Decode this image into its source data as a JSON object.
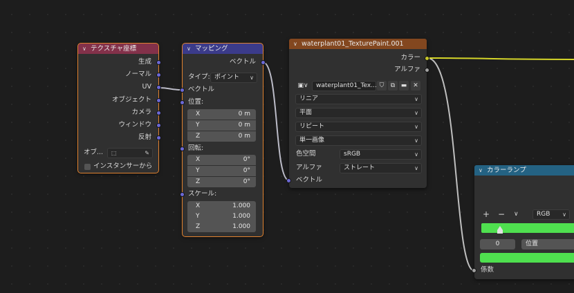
{
  "nodes": {
    "texcoord": {
      "title": "テクスチャ座標",
      "outputs": [
        "生成",
        "ノーマル",
        "UV",
        "オブジェクト",
        "カメラ",
        "ウィンドウ",
        "反射"
      ],
      "object_label": "オブ...",
      "instancer_label": "インスタンサーから",
      "header_color": "#83314a"
    },
    "mapping": {
      "title": "マッピング",
      "vector_out": "ベクトル",
      "type_label": "タイプ:",
      "type_value": "ポイント",
      "vector_in": "ベクトル",
      "location_label": "位置:",
      "location": [
        {
          "axis": "X",
          "value": "0 m"
        },
        {
          "axis": "Y",
          "value": "0 m"
        },
        {
          "axis": "Z",
          "value": "0 m"
        }
      ],
      "rotation_label": "回転:",
      "rotation": [
        {
          "axis": "X",
          "value": "0°"
        },
        {
          "axis": "Y",
          "value": "0°"
        },
        {
          "axis": "Z",
          "value": "0°"
        }
      ],
      "scale_label": "スケール:",
      "scale": [
        {
          "axis": "X",
          "value": "1.000"
        },
        {
          "axis": "Y",
          "value": "1.000"
        },
        {
          "axis": "Z",
          "value": "1.000"
        }
      ],
      "header_color": "#3b3b8a"
    },
    "image_texture": {
      "title": "waterplant01_TexturePaint.001",
      "color_out": "カラー",
      "alpha_out": "アルファ",
      "image_name": "waterplant01_Tex...",
      "interpolation": "リニア",
      "projection": "平面",
      "extension": "リピート",
      "source": "単一画像",
      "colorspace_label": "色空間",
      "colorspace_value": "sRGB",
      "alpha_label": "アルファ",
      "alpha_value": "ストレート",
      "vector_in": "ベクトル",
      "header_color": "#83471f"
    },
    "color_ramp": {
      "title": "カラーランプ",
      "plus": "+",
      "minus": "−",
      "mode": "RGB",
      "stop_index": "0",
      "position_label": "位置",
      "factor_in": "係数",
      "header_color": "#246283",
      "ramp_color": "#4fe04f"
    }
  }
}
